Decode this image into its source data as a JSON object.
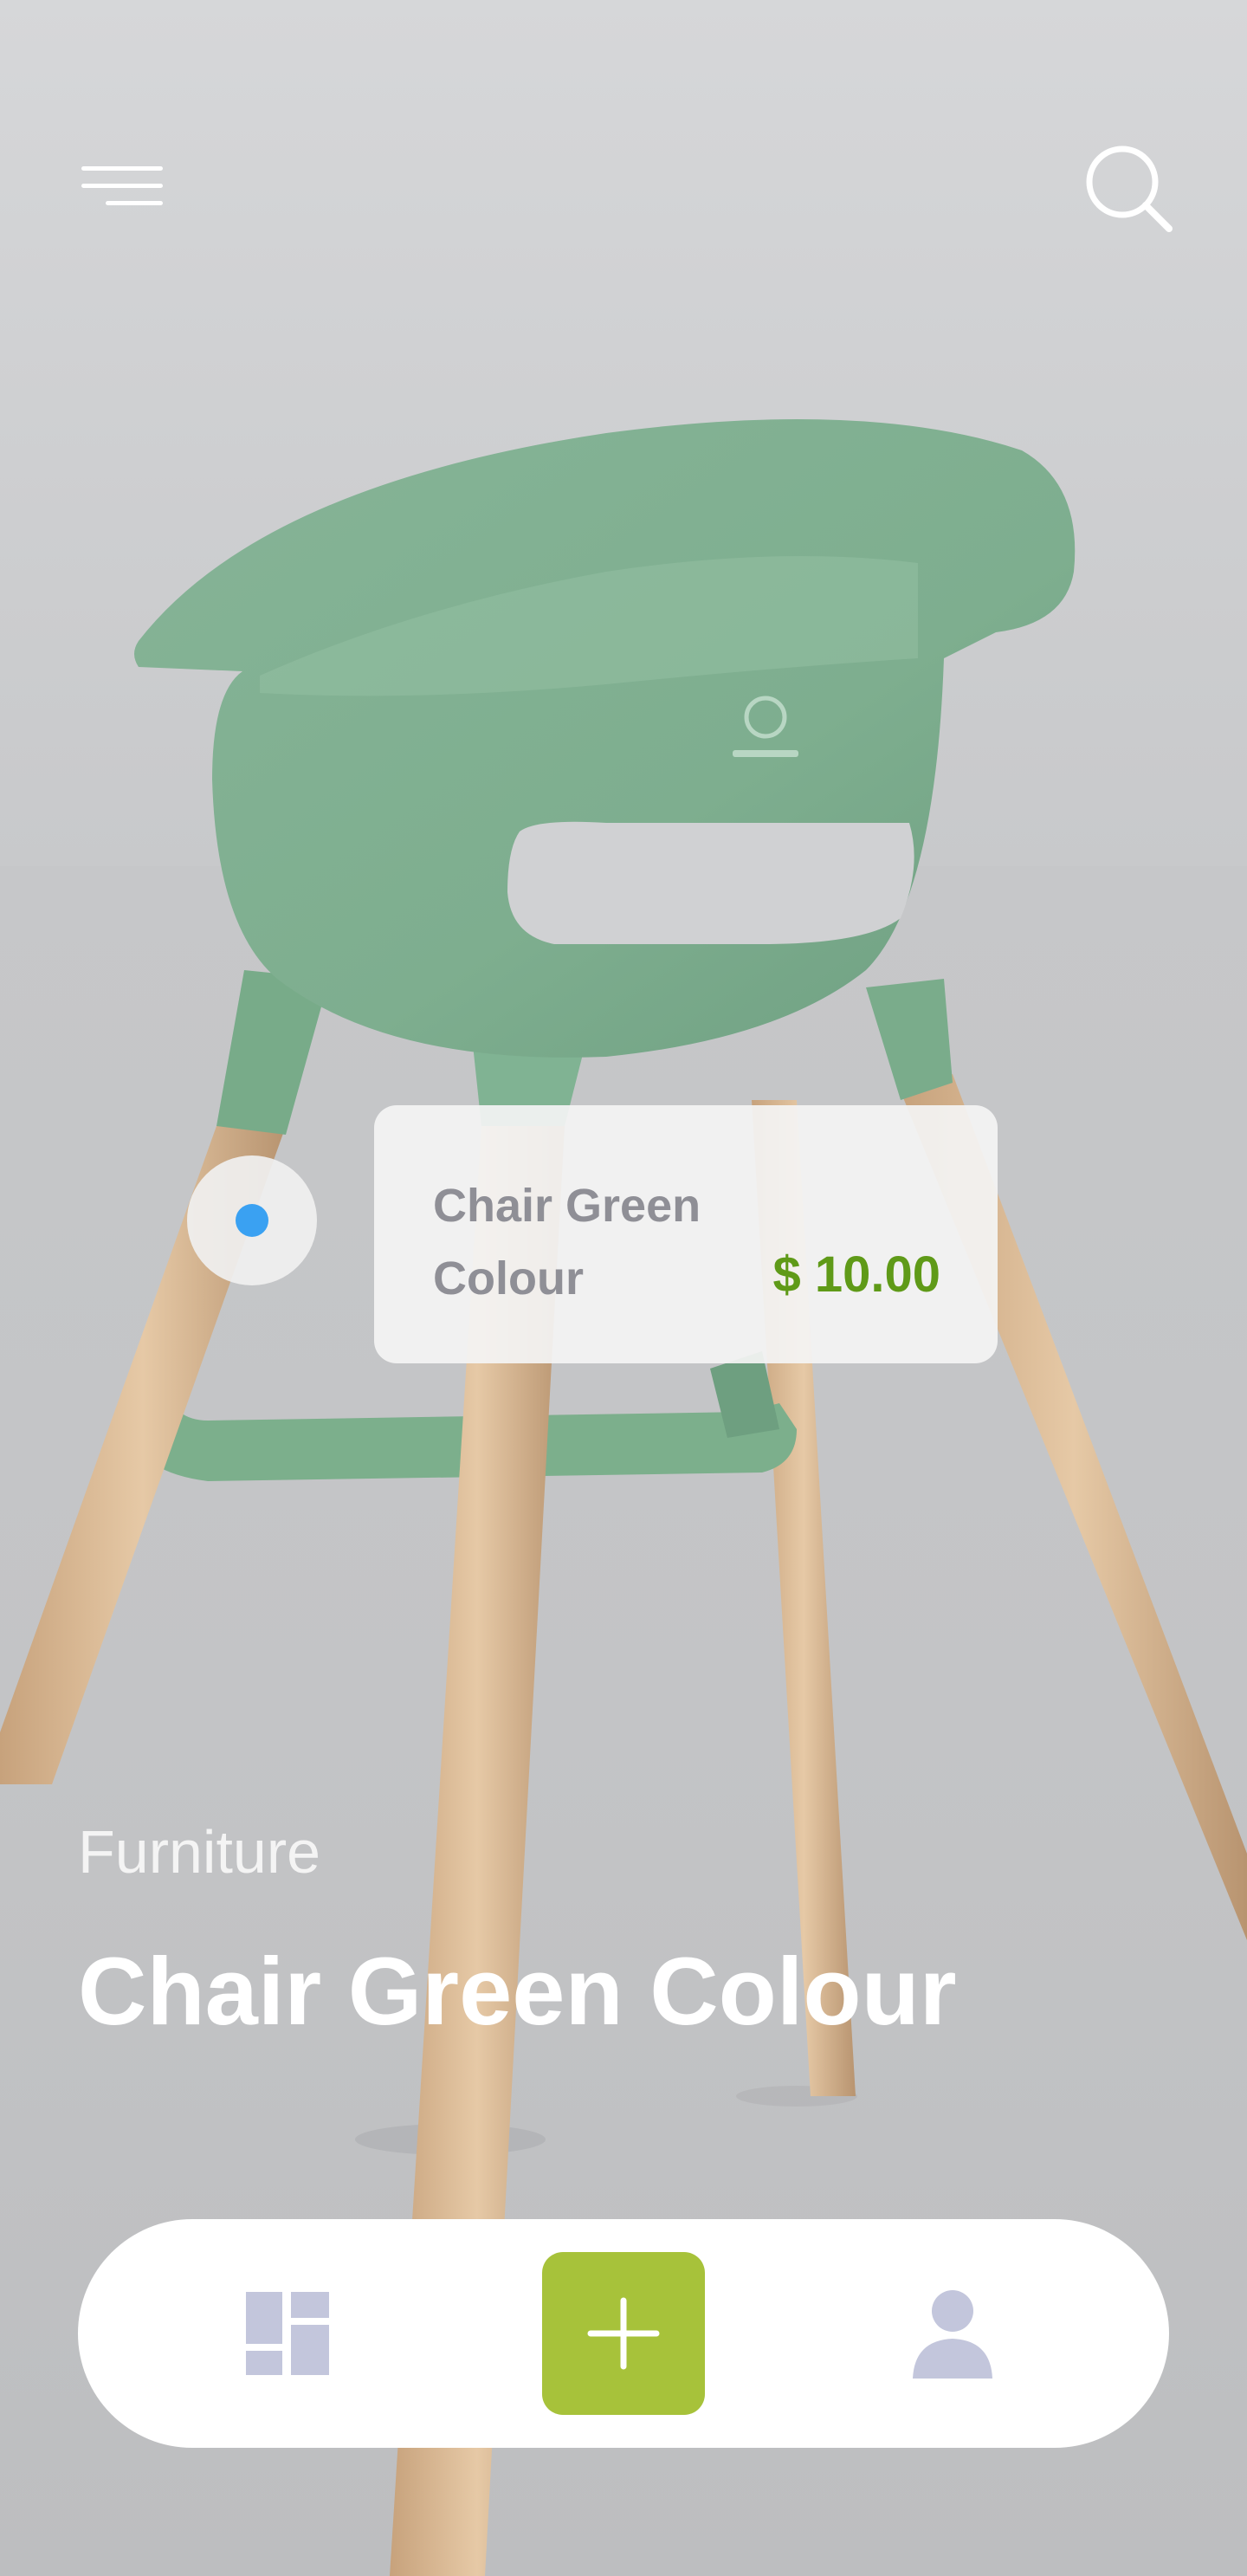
{
  "header": {
    "menu_icon": "hamburger-menu-icon",
    "search_icon": "search-icon"
  },
  "hero_image": {
    "subject": "green high chair with wooden legs"
  },
  "product_card": {
    "name": "Chair Green Colour",
    "price": "$ 10.00"
  },
  "hotspot": {
    "dot_color": "#3aa1f2"
  },
  "product": {
    "category": "Furniture",
    "title": "Chair Green Colour"
  },
  "bottom_nav": {
    "items": [
      {
        "icon": "dashboard-grid-icon"
      },
      {
        "icon": "plus-icon"
      },
      {
        "icon": "profile-icon"
      }
    ]
  },
  "colors": {
    "price": "#5f9a18",
    "accent": "#a7c23a",
    "nav_icon": "#c3c6dc",
    "background": "#c9cacc"
  }
}
